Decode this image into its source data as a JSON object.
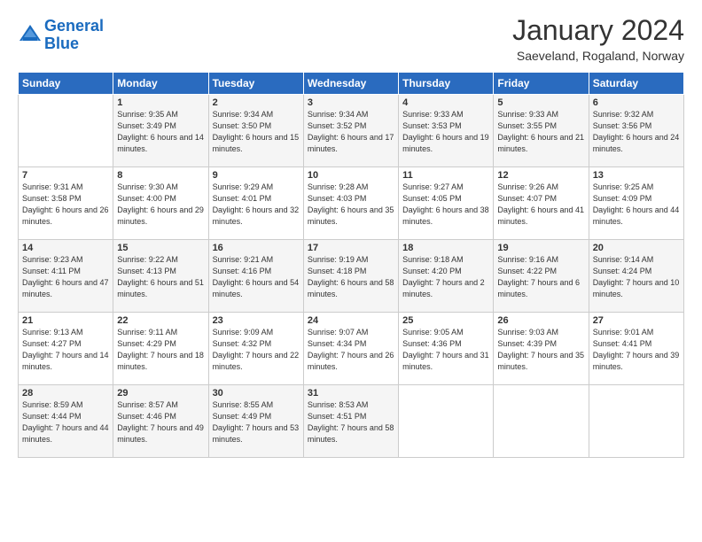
{
  "header": {
    "logo_line1": "General",
    "logo_line2": "Blue",
    "month_title": "January 2024",
    "location": "Saeveland, Rogaland, Norway"
  },
  "days_header": [
    "Sunday",
    "Monday",
    "Tuesday",
    "Wednesday",
    "Thursday",
    "Friday",
    "Saturday"
  ],
  "weeks": [
    [
      {
        "day": "",
        "sunrise": "",
        "sunset": "",
        "daylight": ""
      },
      {
        "day": "1",
        "sunrise": "Sunrise: 9:35 AM",
        "sunset": "Sunset: 3:49 PM",
        "daylight": "Daylight: 6 hours and 14 minutes."
      },
      {
        "day": "2",
        "sunrise": "Sunrise: 9:34 AM",
        "sunset": "Sunset: 3:50 PM",
        "daylight": "Daylight: 6 hours and 15 minutes."
      },
      {
        "day": "3",
        "sunrise": "Sunrise: 9:34 AM",
        "sunset": "Sunset: 3:52 PM",
        "daylight": "Daylight: 6 hours and 17 minutes."
      },
      {
        "day": "4",
        "sunrise": "Sunrise: 9:33 AM",
        "sunset": "Sunset: 3:53 PM",
        "daylight": "Daylight: 6 hours and 19 minutes."
      },
      {
        "day": "5",
        "sunrise": "Sunrise: 9:33 AM",
        "sunset": "Sunset: 3:55 PM",
        "daylight": "Daylight: 6 hours and 21 minutes."
      },
      {
        "day": "6",
        "sunrise": "Sunrise: 9:32 AM",
        "sunset": "Sunset: 3:56 PM",
        "daylight": "Daylight: 6 hours and 24 minutes."
      }
    ],
    [
      {
        "day": "7",
        "sunrise": "Sunrise: 9:31 AM",
        "sunset": "Sunset: 3:58 PM",
        "daylight": "Daylight: 6 hours and 26 minutes."
      },
      {
        "day": "8",
        "sunrise": "Sunrise: 9:30 AM",
        "sunset": "Sunset: 4:00 PM",
        "daylight": "Daylight: 6 hours and 29 minutes."
      },
      {
        "day": "9",
        "sunrise": "Sunrise: 9:29 AM",
        "sunset": "Sunset: 4:01 PM",
        "daylight": "Daylight: 6 hours and 32 minutes."
      },
      {
        "day": "10",
        "sunrise": "Sunrise: 9:28 AM",
        "sunset": "Sunset: 4:03 PM",
        "daylight": "Daylight: 6 hours and 35 minutes."
      },
      {
        "day": "11",
        "sunrise": "Sunrise: 9:27 AM",
        "sunset": "Sunset: 4:05 PM",
        "daylight": "Daylight: 6 hours and 38 minutes."
      },
      {
        "day": "12",
        "sunrise": "Sunrise: 9:26 AM",
        "sunset": "Sunset: 4:07 PM",
        "daylight": "Daylight: 6 hours and 41 minutes."
      },
      {
        "day": "13",
        "sunrise": "Sunrise: 9:25 AM",
        "sunset": "Sunset: 4:09 PM",
        "daylight": "Daylight: 6 hours and 44 minutes."
      }
    ],
    [
      {
        "day": "14",
        "sunrise": "Sunrise: 9:23 AM",
        "sunset": "Sunset: 4:11 PM",
        "daylight": "Daylight: 6 hours and 47 minutes."
      },
      {
        "day": "15",
        "sunrise": "Sunrise: 9:22 AM",
        "sunset": "Sunset: 4:13 PM",
        "daylight": "Daylight: 6 hours and 51 minutes."
      },
      {
        "day": "16",
        "sunrise": "Sunrise: 9:21 AM",
        "sunset": "Sunset: 4:16 PM",
        "daylight": "Daylight: 6 hours and 54 minutes."
      },
      {
        "day": "17",
        "sunrise": "Sunrise: 9:19 AM",
        "sunset": "Sunset: 4:18 PM",
        "daylight": "Daylight: 6 hours and 58 minutes."
      },
      {
        "day": "18",
        "sunrise": "Sunrise: 9:18 AM",
        "sunset": "Sunset: 4:20 PM",
        "daylight": "Daylight: 7 hours and 2 minutes."
      },
      {
        "day": "19",
        "sunrise": "Sunrise: 9:16 AM",
        "sunset": "Sunset: 4:22 PM",
        "daylight": "Daylight: 7 hours and 6 minutes."
      },
      {
        "day": "20",
        "sunrise": "Sunrise: 9:14 AM",
        "sunset": "Sunset: 4:24 PM",
        "daylight": "Daylight: 7 hours and 10 minutes."
      }
    ],
    [
      {
        "day": "21",
        "sunrise": "Sunrise: 9:13 AM",
        "sunset": "Sunset: 4:27 PM",
        "daylight": "Daylight: 7 hours and 14 minutes."
      },
      {
        "day": "22",
        "sunrise": "Sunrise: 9:11 AM",
        "sunset": "Sunset: 4:29 PM",
        "daylight": "Daylight: 7 hours and 18 minutes."
      },
      {
        "day": "23",
        "sunrise": "Sunrise: 9:09 AM",
        "sunset": "Sunset: 4:32 PM",
        "daylight": "Daylight: 7 hours and 22 minutes."
      },
      {
        "day": "24",
        "sunrise": "Sunrise: 9:07 AM",
        "sunset": "Sunset: 4:34 PM",
        "daylight": "Daylight: 7 hours and 26 minutes."
      },
      {
        "day": "25",
        "sunrise": "Sunrise: 9:05 AM",
        "sunset": "Sunset: 4:36 PM",
        "daylight": "Daylight: 7 hours and 31 minutes."
      },
      {
        "day": "26",
        "sunrise": "Sunrise: 9:03 AM",
        "sunset": "Sunset: 4:39 PM",
        "daylight": "Daylight: 7 hours and 35 minutes."
      },
      {
        "day": "27",
        "sunrise": "Sunrise: 9:01 AM",
        "sunset": "Sunset: 4:41 PM",
        "daylight": "Daylight: 7 hours and 39 minutes."
      }
    ],
    [
      {
        "day": "28",
        "sunrise": "Sunrise: 8:59 AM",
        "sunset": "Sunset: 4:44 PM",
        "daylight": "Daylight: 7 hours and 44 minutes."
      },
      {
        "day": "29",
        "sunrise": "Sunrise: 8:57 AM",
        "sunset": "Sunset: 4:46 PM",
        "daylight": "Daylight: 7 hours and 49 minutes."
      },
      {
        "day": "30",
        "sunrise": "Sunrise: 8:55 AM",
        "sunset": "Sunset: 4:49 PM",
        "daylight": "Daylight: 7 hours and 53 minutes."
      },
      {
        "day": "31",
        "sunrise": "Sunrise: 8:53 AM",
        "sunset": "Sunset: 4:51 PM",
        "daylight": "Daylight: 7 hours and 58 minutes."
      },
      {
        "day": "",
        "sunrise": "",
        "sunset": "",
        "daylight": ""
      },
      {
        "day": "",
        "sunrise": "",
        "sunset": "",
        "daylight": ""
      },
      {
        "day": "",
        "sunrise": "",
        "sunset": "",
        "daylight": ""
      }
    ]
  ]
}
